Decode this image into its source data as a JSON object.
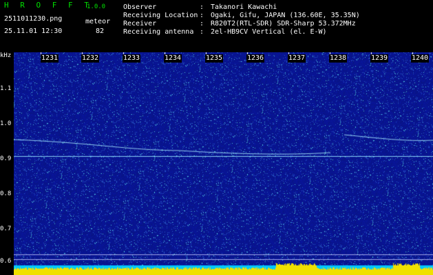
{
  "app": {
    "name": "H R O F F T",
    "version": "1.0.0"
  },
  "file": {
    "name": "2511011230.png",
    "datetime": "25.11.01 12:30"
  },
  "meteor": {
    "label": "meteor",
    "count": "82"
  },
  "info": [
    {
      "key": "Observer",
      "sep": ":",
      "value": "Takanori Kawachi"
    },
    {
      "key": "Receiving Location",
      "sep": ":",
      "value": "Ogaki, Gifu, JAPAN (136.60E, 35.35N)"
    },
    {
      "key": "Receiver",
      "sep": ":",
      "value": "R820T2(RTL-SDR) SDR-Sharp 53.372MHz"
    },
    {
      "key": "Receiving antenna",
      "sep": ":",
      "value": "2el-HB9CV Vertical (el. E-W)"
    }
  ],
  "axis": {
    "unit": "kHz",
    "x_ticks": [
      "1231",
      "1232",
      "1233",
      "1234",
      "1235",
      "1236",
      "1237",
      "1238",
      "1239",
      "1240"
    ],
    "y_ticks": [
      "1.1",
      "1.0",
      "0.9",
      "0.8",
      "0.7",
      "0.6"
    ]
  },
  "colors": {
    "background": "#000000",
    "spectrum_bg": "#0a1a8c",
    "text": "#ffffff",
    "title": "#00e000",
    "level_bar": "#f0e000",
    "level_bar_bg": "#00c8ff"
  }
}
